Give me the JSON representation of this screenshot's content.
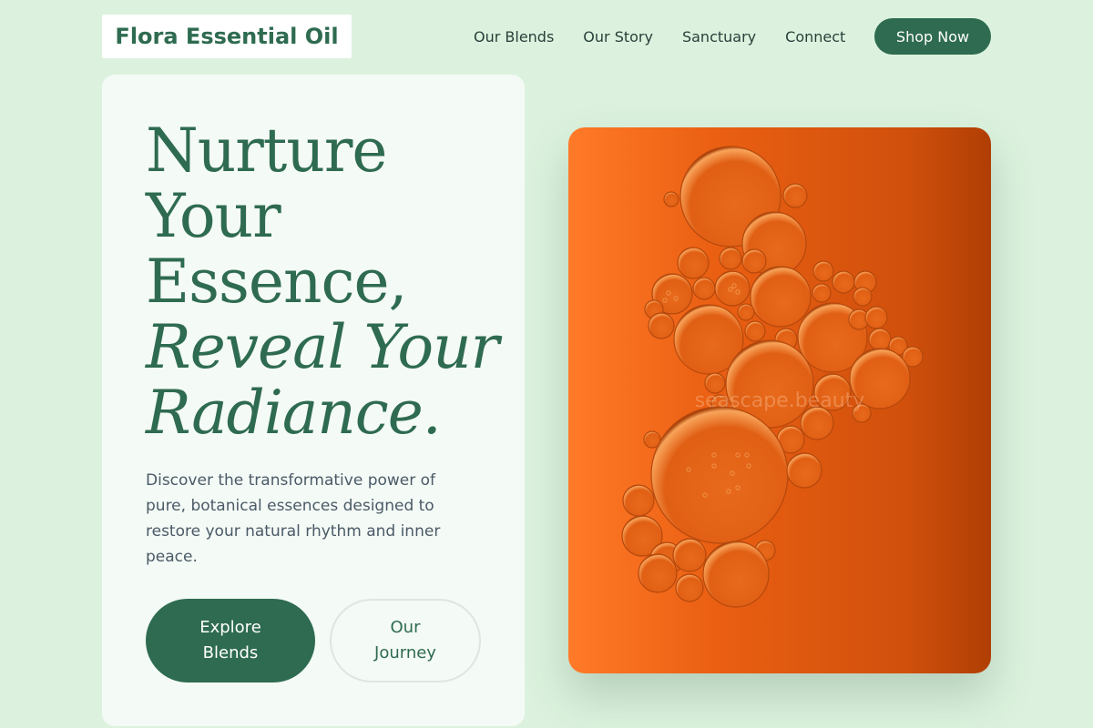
{
  "header": {
    "logo_text": "Flora Essential Oil",
    "nav": [
      {
        "label": "Our Blends"
      },
      {
        "label": "Our Story"
      },
      {
        "label": "Sanctuary"
      },
      {
        "label": "Connect"
      }
    ],
    "cta_label": "Shop Now"
  },
  "hero": {
    "headline_lines": [
      "Nurture",
      "Your",
      "Essence,"
    ],
    "headline_italic_lines": [
      "Reveal Your",
      "Radiance."
    ],
    "description": "Discover the transformative power of pure, botanical essences designed to restore your natural rhythm and inner peace.",
    "primary_button": "Explore Blends",
    "secondary_button": "Our Journey"
  },
  "image": {
    "watermark": "seascape.beauty",
    "subject": "oil-bubbles-on-orange"
  },
  "colors": {
    "background": "#dcf2de",
    "brand_green": "#2e6b50",
    "card": "#f4faf6",
    "image_orange": "#e8621a"
  }
}
